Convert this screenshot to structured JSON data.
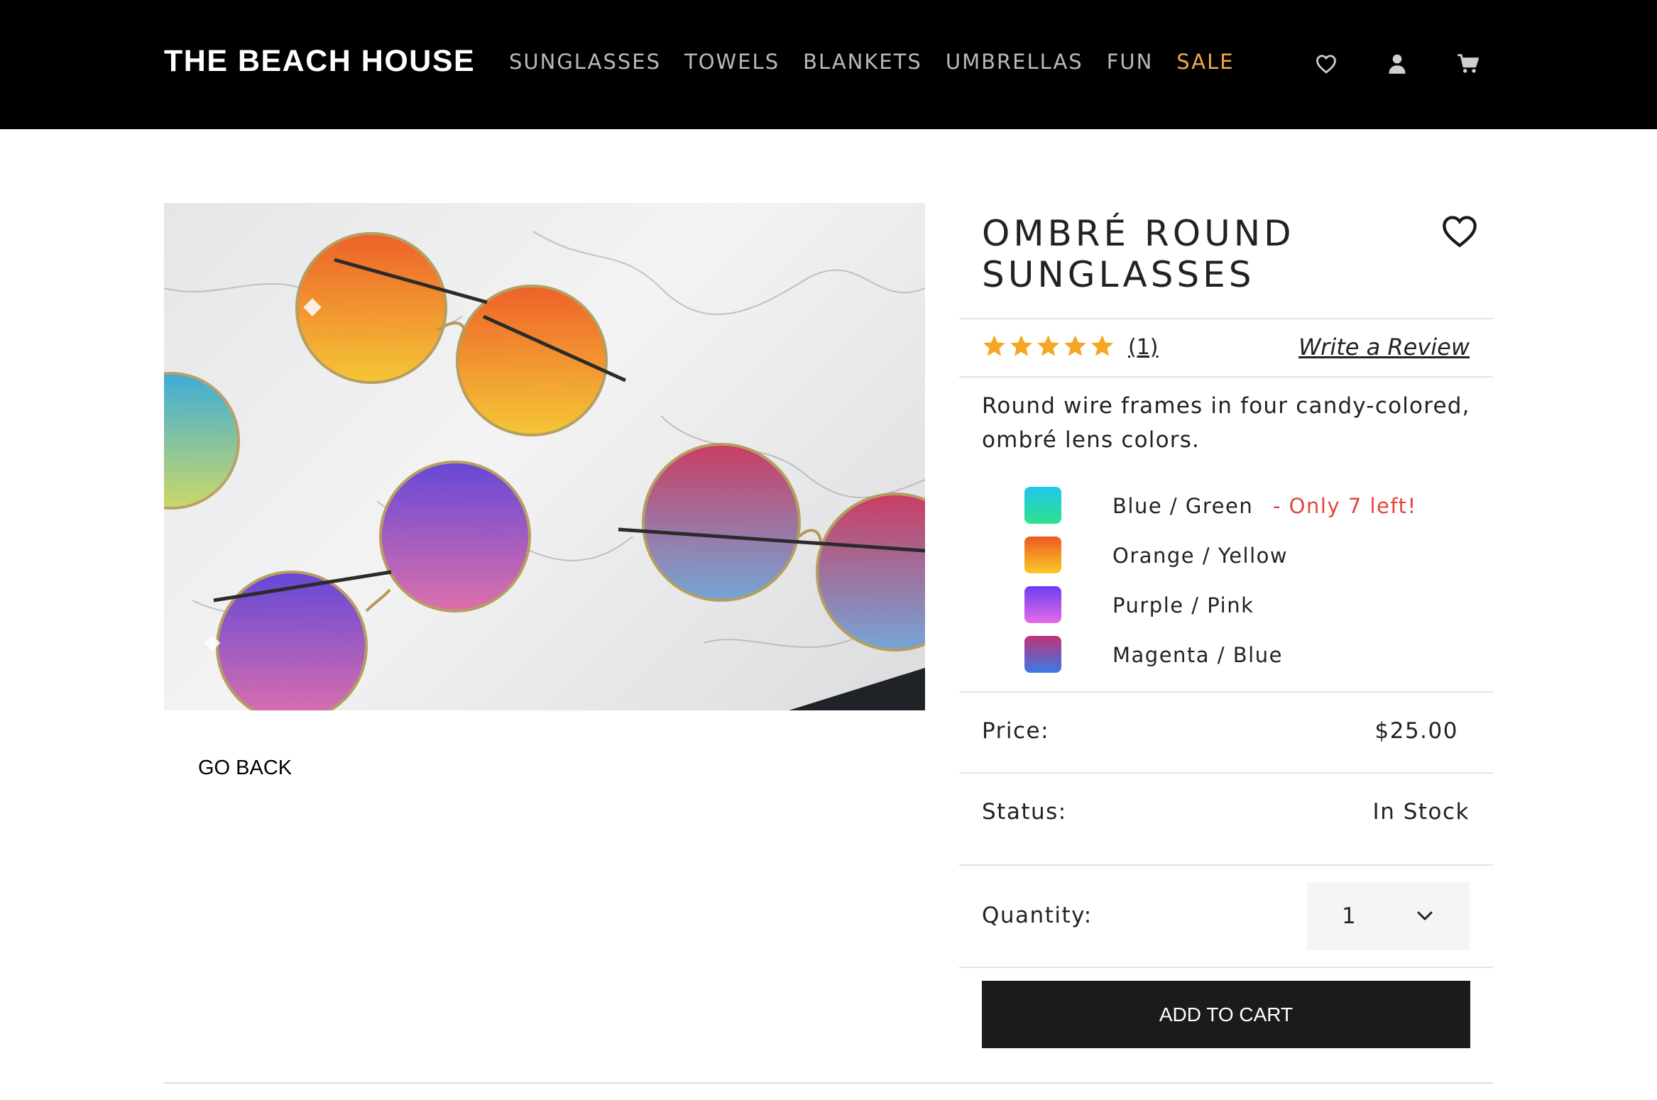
{
  "header": {
    "brand": "THE BEACH HOUSE",
    "nav": [
      "SUNGLASSES",
      "TOWELS",
      "BLANKETS",
      "UMBRELLAS",
      "FUN",
      "SALE"
    ],
    "icons": [
      "heart-icon",
      "user-icon",
      "cart-icon"
    ],
    "colors": {
      "background": "#000000",
      "nav_text": "#b9b9b9",
      "sale": "#f3a84a"
    }
  },
  "product": {
    "title": "OMBRÉ ROUND SUNGLASSES",
    "rating": 5,
    "review_count": "(1)",
    "write_review": "Write a Review",
    "description": "Round wire frames in four candy-colored, ombré lens colors.",
    "colors": [
      {
        "label": "Blue / Green",
        "note": "- Only 7 left!",
        "swatch": [
          "#1fc6ee",
          "#2ee28a"
        ]
      },
      {
        "label": "Orange / Yellow",
        "note": "",
        "swatch": [
          "#ee5a1f",
          "#f9cb2a"
        ]
      },
      {
        "label": "Purple / Pink",
        "note": "",
        "swatch": [
          "#6b3df2",
          "#e86ae6"
        ]
      },
      {
        "label": "Magenta / Blue",
        "note": "",
        "swatch": [
          "#c0327a",
          "#3a7ae8"
        ]
      }
    ],
    "price_label": "Price:",
    "price": "$25.00",
    "status_label": "Status:",
    "status": "In Stock",
    "quantity_label": "Quantity:",
    "quantity": "1",
    "add_to_cart": "ADD TO CART",
    "go_back": "GO BACK",
    "star_color": "#f5a623"
  }
}
